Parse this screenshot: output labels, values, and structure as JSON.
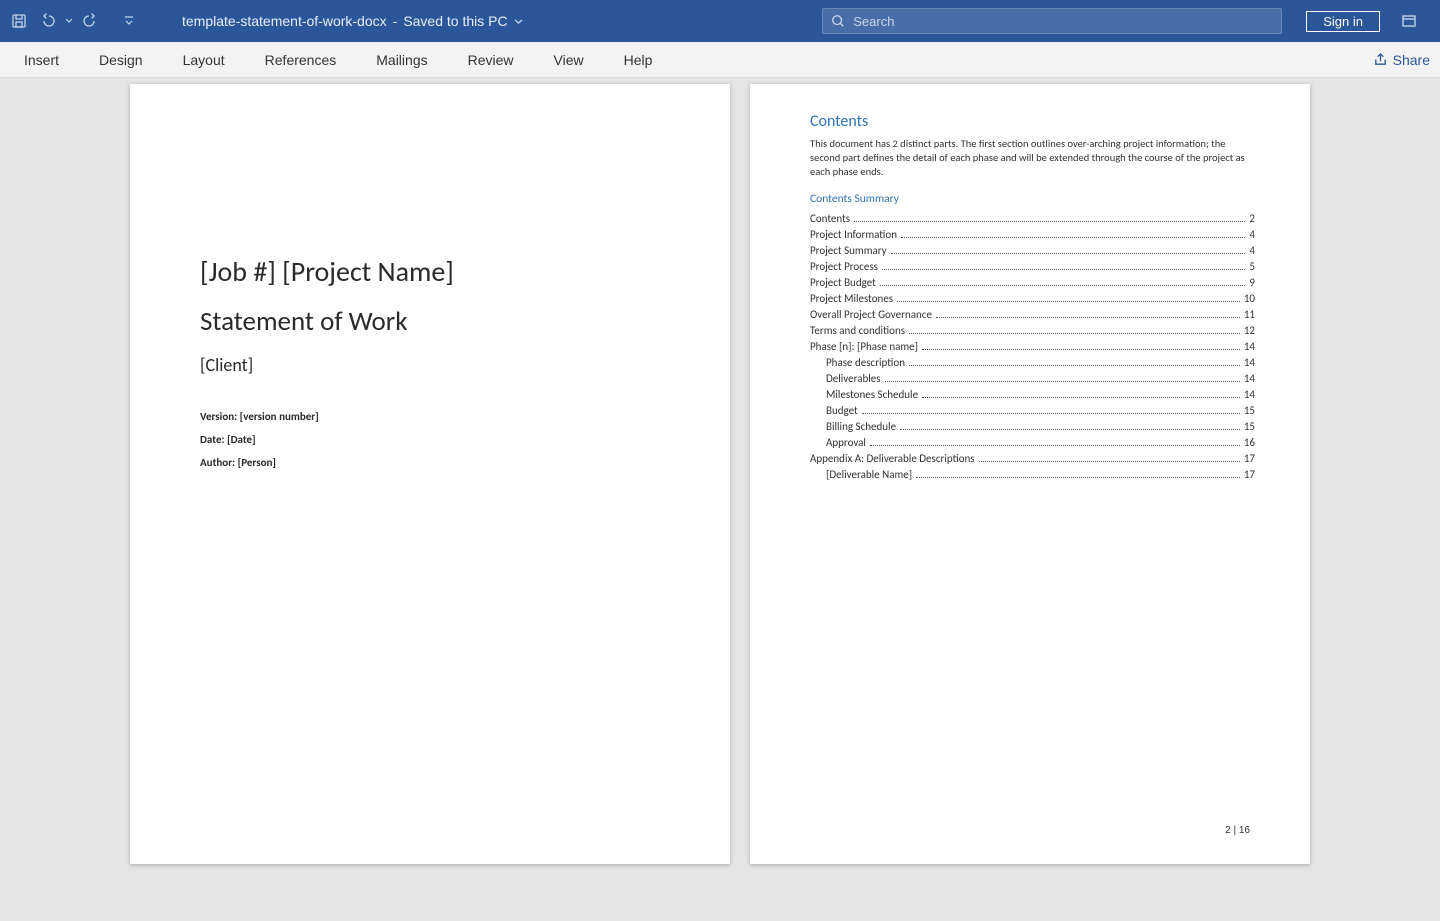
{
  "titlebar": {
    "filename": "template-statement-of-work-docx",
    "save_status": "Saved to this PC",
    "search_placeholder": "Search",
    "sign_in": "Sign in"
  },
  "ribbon": {
    "tabs": [
      "Insert",
      "Design",
      "Layout",
      "References",
      "Mailings",
      "Review",
      "View",
      "Help"
    ],
    "share": "Share"
  },
  "page1": {
    "h1": "[Job #] [Project Name]",
    "h2": "Statement of Work",
    "h3": "[Client]",
    "meta_version": "Version: [version number]",
    "meta_date": "Date: [Date]",
    "meta_author": "Author: [Person]"
  },
  "page2": {
    "heading": "Contents",
    "intro": "This document has 2 distinct parts. The first section outlines over-arching project information; the second part defines the detail of each phase and will be extended through the course of the project as each phase ends.",
    "subheading": "Contents Summary",
    "toc": [
      {
        "label": "Contents",
        "page": "2",
        "indent": false
      },
      {
        "label": "Project Information",
        "page": "4",
        "indent": false
      },
      {
        "label": "Project Summary",
        "page": "4",
        "indent": false
      },
      {
        "label": "Project Process",
        "page": "5",
        "indent": false
      },
      {
        "label": "Project Budget",
        "page": "9",
        "indent": false
      },
      {
        "label": "Project Milestones",
        "page": "10",
        "indent": false
      },
      {
        "label": "Overall Project Governance",
        "page": "11",
        "indent": false
      },
      {
        "label": "Terms and conditions",
        "page": "12",
        "indent": false
      },
      {
        "label": "Phase [n]:  [Phase name]",
        "page": "14",
        "indent": false
      },
      {
        "label": "Phase description",
        "page": "14",
        "indent": true
      },
      {
        "label": "Deliverables",
        "page": "14",
        "indent": true
      },
      {
        "label": "Milestones Schedule",
        "page": "14",
        "indent": true
      },
      {
        "label": "Budget",
        "page": "15",
        "indent": true
      },
      {
        "label": "Billing Schedule",
        "page": "15",
        "indent": true
      },
      {
        "label": "Approval",
        "page": "16",
        "indent": true
      },
      {
        "label": "Appendix A: Deliverable Descriptions",
        "page": "17",
        "indent": false
      },
      {
        "label": "[Deliverable Name]",
        "page": "17",
        "indent": true
      }
    ],
    "footer": "2 | 16"
  }
}
